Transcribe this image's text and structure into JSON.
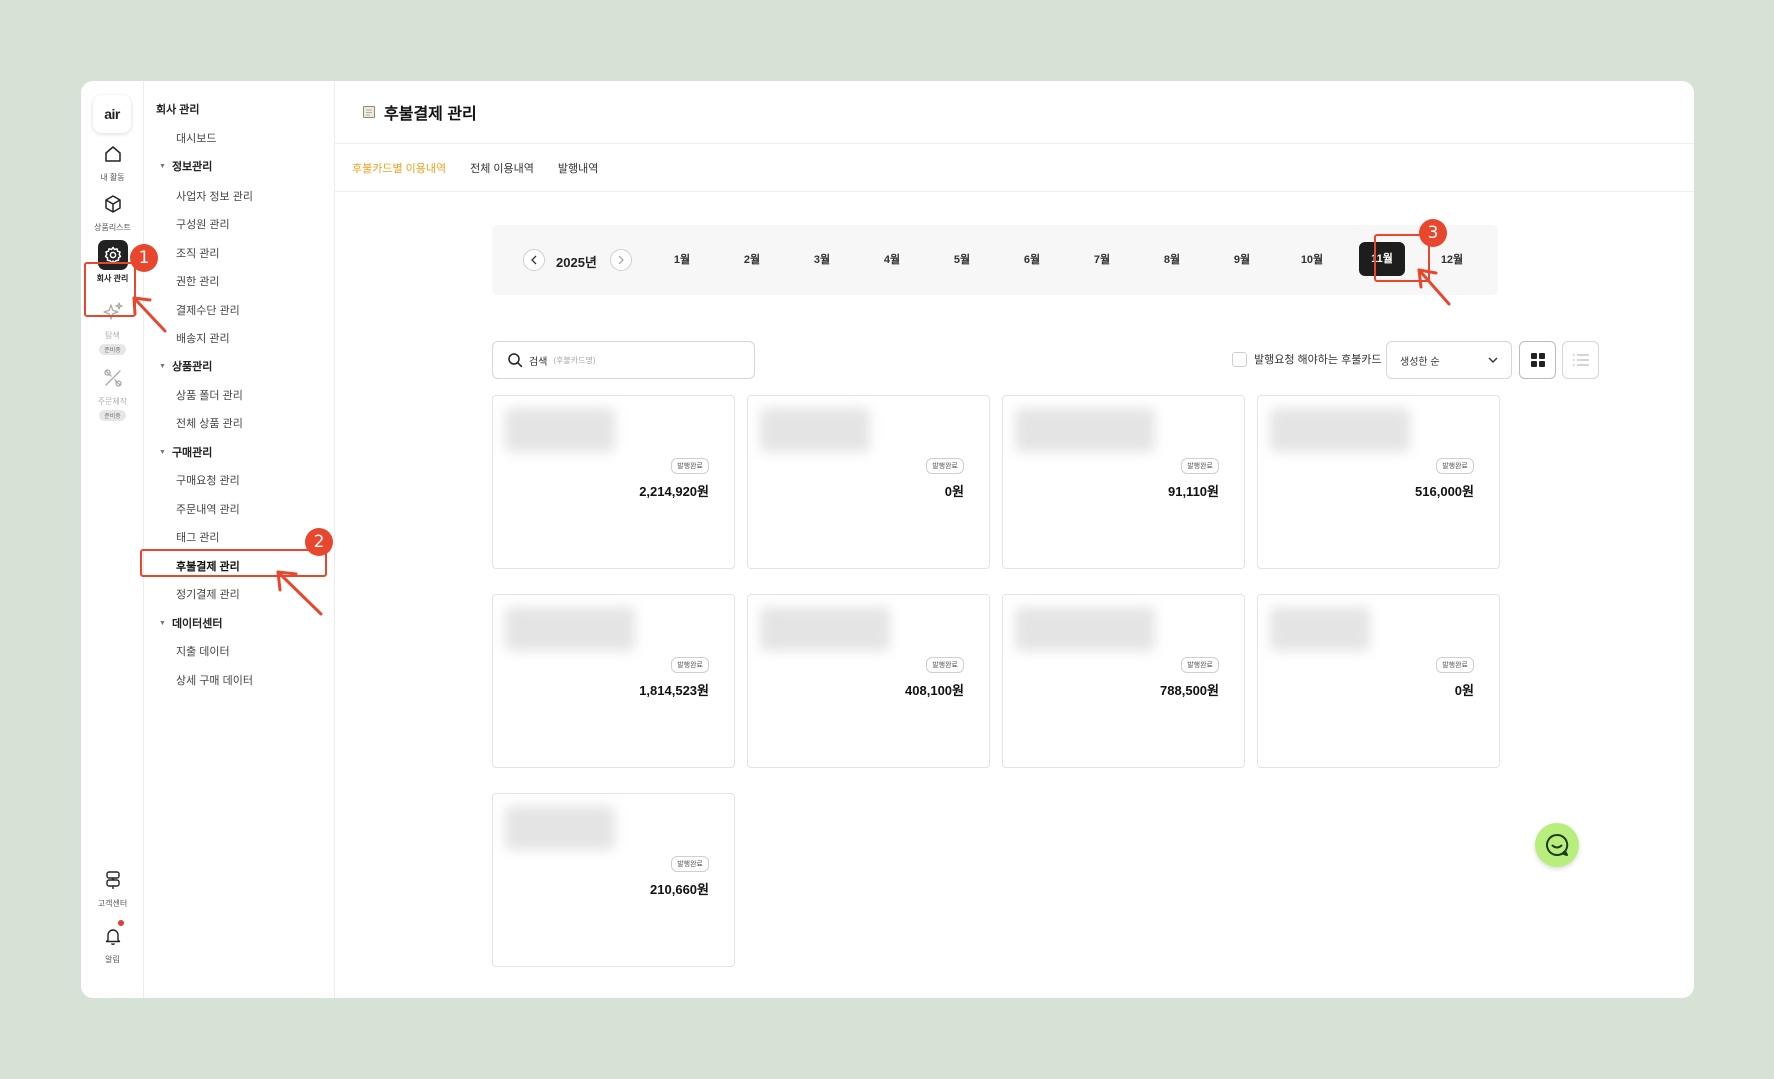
{
  "rail": {
    "logo": "air",
    "items": [
      {
        "label": "내 활동",
        "icon": "home-icon"
      },
      {
        "label": "상품리스트",
        "icon": "box-icon"
      },
      {
        "label": "회사 관리",
        "icon": "gear-icon"
      },
      {
        "label": "탐색",
        "icon": "sparkle-icon",
        "badge": "준비중"
      },
      {
        "label": "주문제작",
        "icon": "tools-icon",
        "badge": "준비중"
      },
      {
        "label": "고객센터",
        "icon": "signpost-icon"
      },
      {
        "label": "알림",
        "icon": "bell-icon"
      }
    ]
  },
  "menu": {
    "root": "회사 관리",
    "dashboard": "대시보드",
    "groups": [
      {
        "label": "정보관리",
        "items": [
          "사업자 정보 관리",
          "구성원 관리",
          "조직 관리",
          "권한 관리",
          "결제수단 관리",
          "배송지 관리"
        ]
      },
      {
        "label": "상품관리",
        "items": [
          "상품 폴더 관리",
          "전체 상품 관리"
        ]
      },
      {
        "label": "구매관리",
        "items": [
          "구매요청 관리",
          "주문내역 관리",
          "태그 관리",
          "후불결제 관리",
          "정기결제 관리"
        ]
      },
      {
        "label": "데이터센터",
        "items": [
          "지출 데이터",
          "상세 구매 데이터"
        ]
      }
    ]
  },
  "page": {
    "title": "후불결제 관리",
    "tabs": [
      "후불카드별 이용내역",
      "전체 이용내역",
      "발행내역"
    ]
  },
  "calendar": {
    "year": "2025년",
    "months": [
      "1월",
      "2월",
      "3월",
      "4월",
      "5월",
      "6월",
      "7월",
      "8월",
      "9월",
      "10월",
      "11월",
      "12월"
    ],
    "selected": "11월"
  },
  "toolbar": {
    "search_label": "검색",
    "search_placeholder": "(후불카드명)",
    "filter_label": "발행요청 해야하는 후불카드",
    "sort_value": "생성한 순"
  },
  "cards": [
    {
      "badge": "발행완료",
      "amount": "2,214,920원"
    },
    {
      "badge": "발행완료",
      "amount": "0원"
    },
    {
      "badge": "발행완료",
      "amount": "91,110원"
    },
    {
      "badge": "발행완료",
      "amount": "516,000원"
    },
    {
      "badge": "발행완료",
      "amount": "1,814,523원"
    },
    {
      "badge": "발행완료",
      "amount": "408,100원"
    },
    {
      "badge": "발행완료",
      "amount": "788,500원"
    },
    {
      "badge": "발행완료",
      "amount": "0원"
    },
    {
      "badge": "발행완료",
      "amount": "210,660원"
    }
  ],
  "annotations": [
    "1",
    "2",
    "3"
  ],
  "colors": {
    "accent": "#f0a020",
    "annotation": "#e8472d",
    "chat": "#b7ee7c",
    "background": "#d7e2d6"
  }
}
